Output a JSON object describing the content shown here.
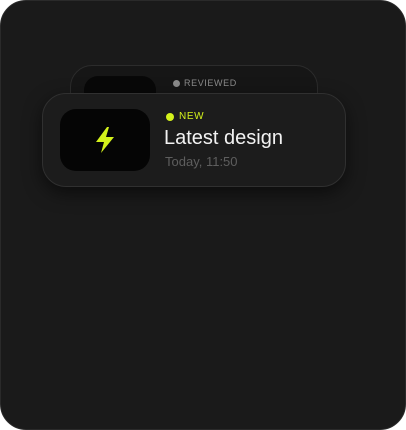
{
  "notifications": [
    {
      "status": "REVIEWED",
      "status_color": "#8a8a8a"
    },
    {
      "status": "NEW",
      "status_color": "#d4f21b",
      "title": "Latest design",
      "time": "Today, 11:50",
      "icon": "lightning-bolt-icon",
      "icon_color": "#d4f21b"
    }
  ],
  "colors": {
    "panel_background": "#1a1a1a",
    "card_background": "#1c1c1c",
    "thumbnail_background": "#050505",
    "accent": "#d4f21b"
  }
}
